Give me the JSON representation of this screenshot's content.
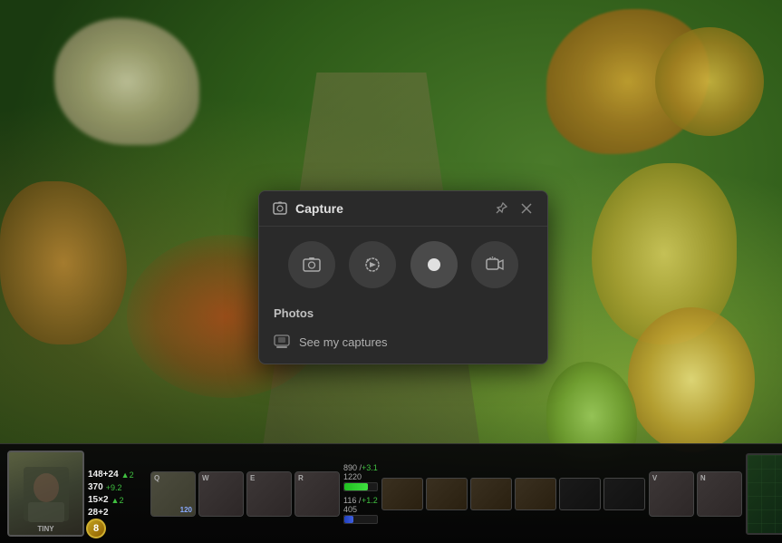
{
  "game": {
    "hero_name": "TINY",
    "level": "8",
    "health": {
      "current": "890",
      "max": "1220",
      "percent": 73,
      "delta": "+3.1"
    },
    "mana": {
      "current": "116",
      "max": "405",
      "percent": 29,
      "delta": "+1.2"
    },
    "stats": [
      {
        "label": "148+24",
        "delta": "2"
      },
      {
        "label": "370",
        "delta": "+9.2"
      },
      {
        "label": "15×2",
        "delta": "2"
      },
      {
        "label": "28+2",
        "delta": ""
      }
    ],
    "abilities": [
      {
        "key": "Q",
        "cooldown": "120"
      },
      {
        "key": "W",
        "cooldown": ""
      },
      {
        "key": "E",
        "cooldown": ""
      },
      {
        "key": "R",
        "cooldown": ""
      },
      {
        "key": "V",
        "cooldown": ""
      },
      {
        "key": "N",
        "cooldown": ""
      }
    ]
  },
  "capture_dialog": {
    "title": "Capture",
    "pin_label": "pin",
    "close_label": "close",
    "tools": [
      {
        "id": "screenshot",
        "label": "Screenshot",
        "icon": "camera"
      },
      {
        "id": "instant-replay",
        "label": "Instant Replay",
        "icon": "replay"
      },
      {
        "id": "record",
        "label": "Record",
        "icon": "record"
      },
      {
        "id": "webcam",
        "label": "Webcam",
        "icon": "webcam"
      }
    ],
    "section_label": "Photos",
    "link": {
      "icon": "gallery",
      "text": "See my captures"
    }
  }
}
